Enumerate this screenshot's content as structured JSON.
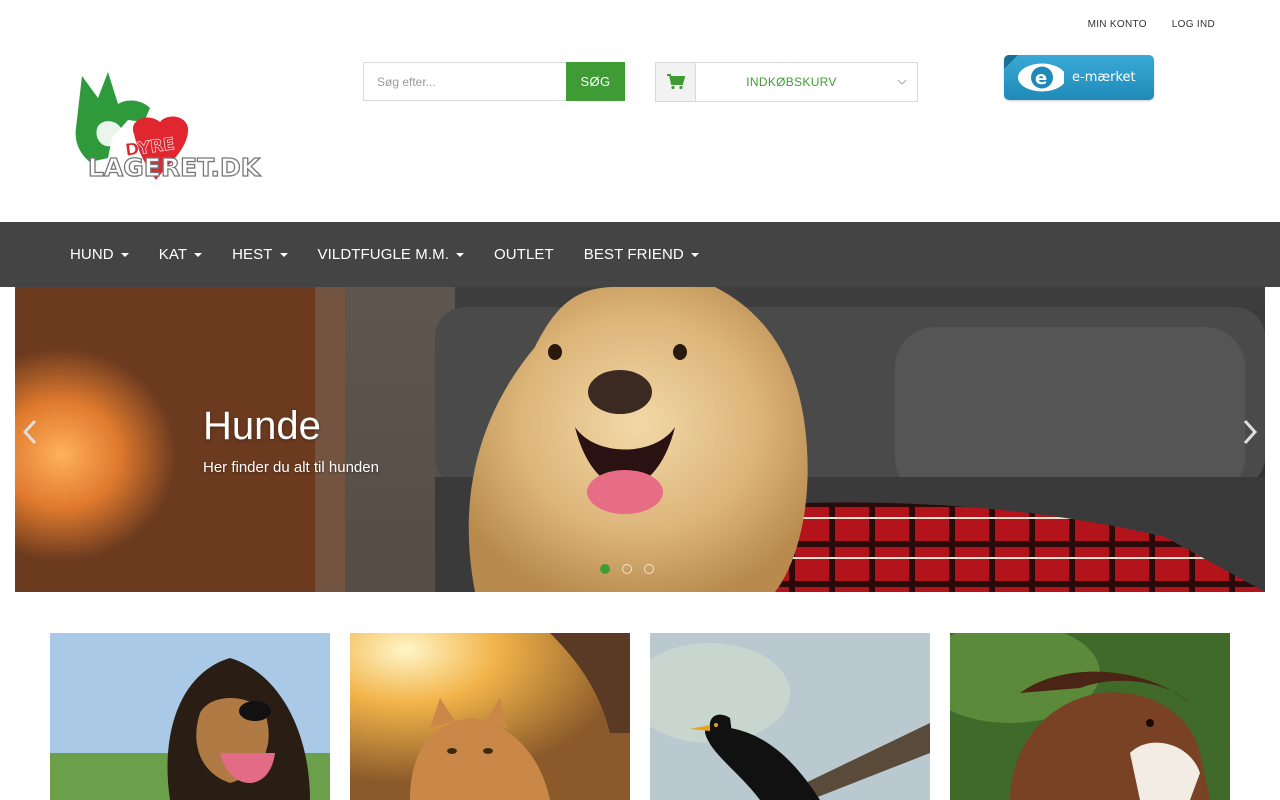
{
  "toplinks": {
    "account": "MIN KONTO",
    "login": "LOG IND"
  },
  "logo": {
    "line1": "DYRE",
    "line2": "LAGERET.DK"
  },
  "search": {
    "placeholder": "Søg efter...",
    "button": "SØG"
  },
  "cart": {
    "label": "INDKØBSKURV"
  },
  "badge": {
    "label": "e-mærket"
  },
  "nav": {
    "items": [
      {
        "label": "HUND",
        "dropdown": true
      },
      {
        "label": "KAT",
        "dropdown": true
      },
      {
        "label": "HEST",
        "dropdown": true
      },
      {
        "label": "VILDTFUGLE M.M.",
        "dropdown": true
      },
      {
        "label": "OUTLET",
        "dropdown": false
      },
      {
        "label": "BEST FRIEND",
        "dropdown": true
      }
    ]
  },
  "hero": {
    "title": "Hunde",
    "subtitle": "Her finder du alt til hunden",
    "slides": 3,
    "active_slide": 1
  },
  "categories": [
    "dog",
    "cat",
    "bird",
    "horse"
  ],
  "colors": {
    "accent": "#3f9c35",
    "nav_bg": "#444444",
    "badge": "#2a9bc9"
  }
}
